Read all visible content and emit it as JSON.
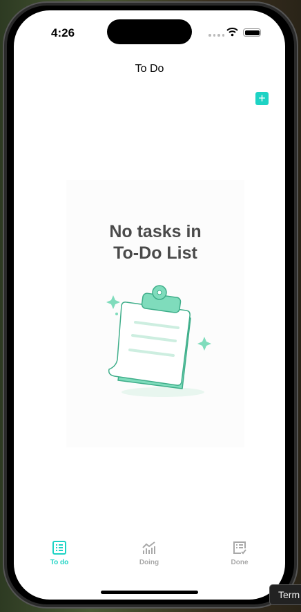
{
  "status_bar": {
    "time": "4:26"
  },
  "nav": {
    "title": "To Do",
    "add_icon": "plus-icon"
  },
  "empty_state": {
    "line1": "No tasks in",
    "line2": "To-Do List"
  },
  "tabs": [
    {
      "label": "To do",
      "icon": "list-icon",
      "active": true
    },
    {
      "label": "Doing",
      "icon": "chart-icon",
      "active": false
    },
    {
      "label": "Done",
      "icon": "checklist-icon",
      "active": false
    }
  ],
  "tooltip": "Term",
  "colors": {
    "accent": "#1dd3c4",
    "illustration": "#7fdcbc"
  }
}
